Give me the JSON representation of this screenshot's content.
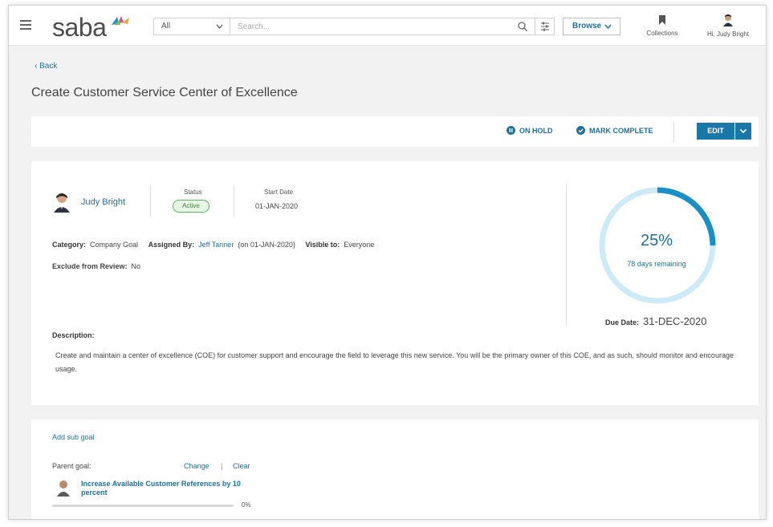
{
  "header": {
    "logo_text": "saba",
    "search_scope": "All",
    "search_placeholder": "Search...",
    "browse_label": "Browse",
    "collections_label": "Collections",
    "user_greeting": "Hi, Judy Bright"
  },
  "page": {
    "back_label": "‹ Back",
    "title": "Create Customer Service Center of Excellence"
  },
  "actions": {
    "on_hold": "ON HOLD",
    "mark_complete": "MARK COMPLETE",
    "edit": "EDIT"
  },
  "goal": {
    "owner_name": "Judy Bright",
    "status_label": "Status",
    "status_value": "Active",
    "start_date_label": "Start Date",
    "start_date_value": "01-JAN-2020",
    "category_label": "Category:",
    "category_value": "Company Goal",
    "assigned_by_label": "Assigned By:",
    "assigned_by_value": "Jeff Tanner",
    "assigned_on": "(on 01-JAN-2020)",
    "visible_to_label": "Visible to:",
    "visible_to_value": "Everyone",
    "exclude_label": "Exclude from Review:",
    "exclude_value": "No",
    "progress_percent": 25,
    "progress_text": "25%",
    "remaining_text": "78 days remaining",
    "due_label": "Due Date:",
    "due_value": "31-DEC-2020",
    "description_label": "Description:",
    "description_text": "Create and maintain a center of excellence (COE) for customer support and encourage the field to leverage this new service. You will be the primary owner of this COE, and as such, should monitor and encourage usage."
  },
  "subgoals": {
    "add_label": "Add sub goal",
    "parent_label": "Parent goal:",
    "change_label": "Change",
    "separator": "|",
    "clear_label": "Clear",
    "parent_goal_title": "Increase Available Customer References by 10 percent",
    "parent_progress": 0,
    "parent_progress_text": "0%"
  },
  "colors": {
    "accent": "#1f6f99",
    "button": "#1a78a8",
    "ring_track": "#cdeaf7",
    "ring_fill": "#1a8fc6",
    "status_green": "#5bb75b"
  }
}
